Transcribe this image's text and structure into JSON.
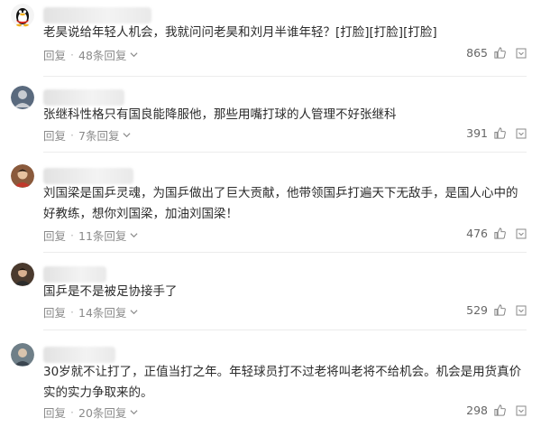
{
  "comments": [
    {
      "avatar_icon": "qq-penguin-avatar",
      "text": "老昊说给年轻人机会，我就问问老昊和刘月半谁年轻？[打脸][打脸][打脸]",
      "reply_label": "回复",
      "replies_label": "48条回复",
      "likes": "865"
    },
    {
      "avatar_icon": "user-avatar",
      "text": "张继科性格只有国良能降服他，那些用嘴打球的人管理不好张继科",
      "reply_label": "回复",
      "replies_label": "7条回复",
      "likes": "391"
    },
    {
      "avatar_icon": "user-avatar",
      "text": "刘国梁是国乒灵魂，为国乒做出了巨大贡献，他带领国乒打遍天下无敌手，是国人心中的好教练，想你刘国梁，加油刘国梁！",
      "reply_label": "回复",
      "replies_label": "11条回复",
      "likes": "476"
    },
    {
      "avatar_icon": "user-avatar",
      "text": "国乒是不是被足协接手了",
      "reply_label": "回复",
      "replies_label": "14条回复",
      "likes": "529"
    },
    {
      "avatar_icon": "user-avatar",
      "text": "30岁就不让打了，正值当打之年。年轻球员打不过老将叫老将不给机会。机会是用货真价实的实力争取来的。",
      "reply_label": "回复",
      "replies_label": "20条回复",
      "likes": "298"
    }
  ],
  "colors": {
    "meta_text": "#8a8a8a",
    "body_text": "#2b2b2b",
    "divider": "#ececec"
  }
}
